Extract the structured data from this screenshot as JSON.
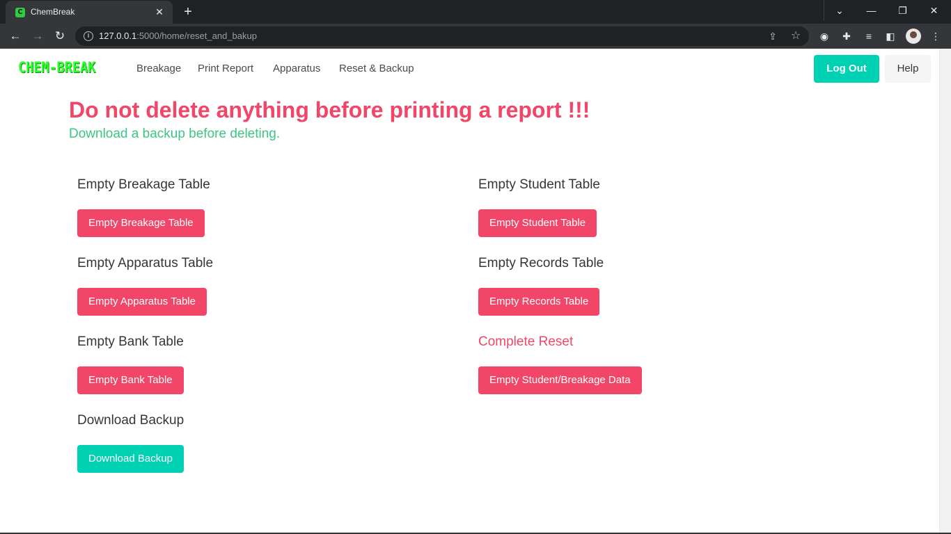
{
  "browser": {
    "tab_title": "ChemBreak",
    "url_host": "127.0.0.1",
    "url_rest": ":5000/home/reset_and_bakup"
  },
  "nav": {
    "logo": "CHEM-BREAK",
    "links": [
      "Breakage",
      "Print Report",
      "Apparatus",
      "Reset & Backup"
    ],
    "logout": "Log Out",
    "help": "Help"
  },
  "warning": {
    "title": "Do not delete anything before printing a report !!!",
    "subtitle": "Download a backup before deleting."
  },
  "sections": {
    "breakage": {
      "title": "Empty Breakage Table",
      "button": "Empty Breakage Table"
    },
    "apparatus": {
      "title": "Empty Apparatus Table",
      "button": "Empty Apparatus Table"
    },
    "bank": {
      "title": "Empty Bank Table",
      "button": "Empty Bank Table"
    },
    "backup": {
      "title": "Download Backup",
      "button": "Download Backup"
    },
    "student": {
      "title": "Empty Student Table",
      "button": "Empty Student Table"
    },
    "records": {
      "title": "Empty Records Table",
      "button": "Empty Records Table"
    },
    "complete": {
      "title": "Complete Reset",
      "button": "Empty Student/Breakage Data"
    }
  },
  "colors": {
    "danger": "#f14668",
    "primary": "#00d1b2",
    "success": "#3ec487",
    "logo": "#2bff2b"
  }
}
